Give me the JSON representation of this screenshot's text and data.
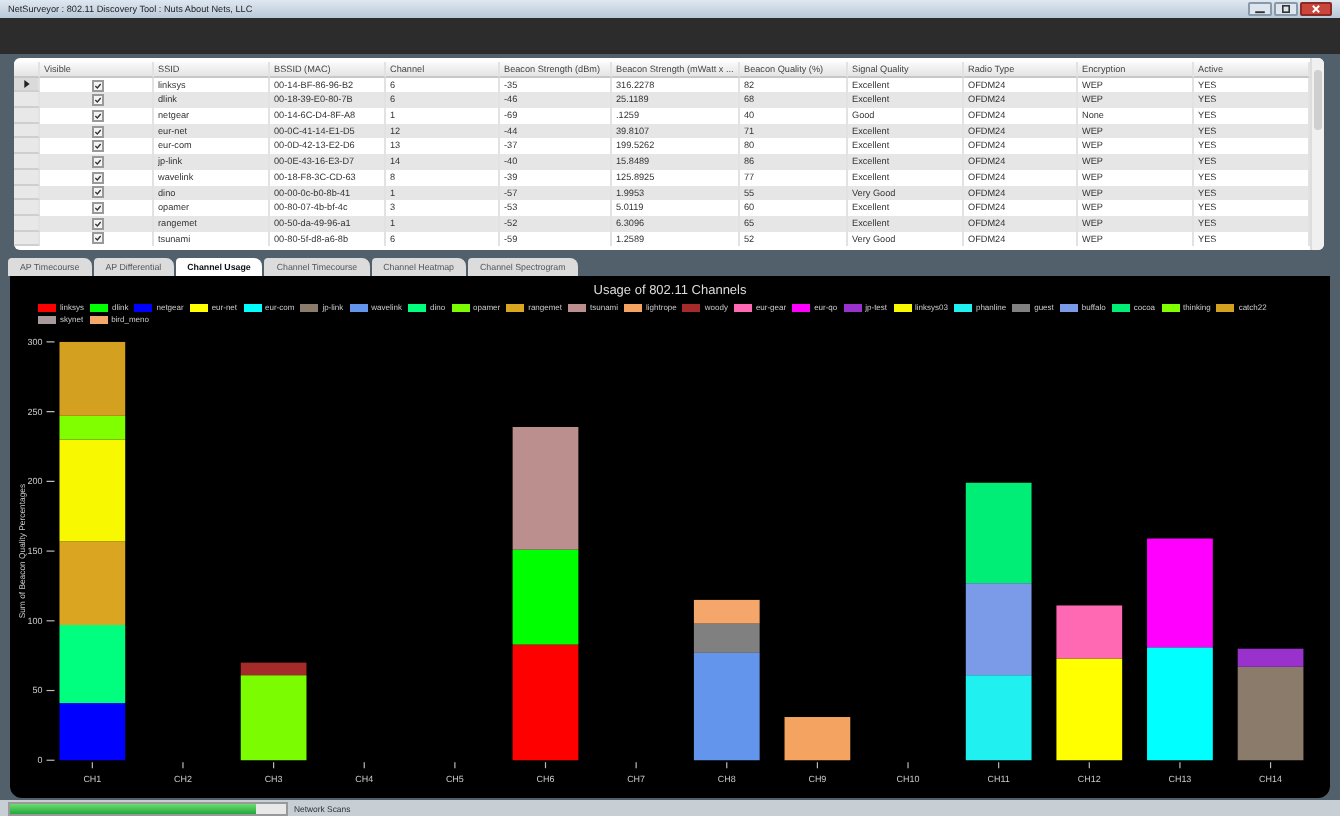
{
  "window": {
    "title": "NetSurveyor : 802.11 Discovery Tool : Nuts About Nets, LLC"
  },
  "table": {
    "columns": [
      "Visible",
      "SSID",
      "BSSID (MAC)",
      "Channel",
      "Beacon Strength (dBm)",
      "Beacon Strength (mWatt x ...",
      "Beacon Quality (%)",
      "Signal Quality",
      "Radio Type",
      "Encryption",
      "Active"
    ],
    "rows": [
      {
        "selected": true,
        "cells": [
          {
            "kind": "checkbox",
            "checked": true
          },
          "linksys",
          "00-14-BF-86-96-B2",
          "6",
          "-35",
          "316.2278",
          "82",
          "Excellent",
          "OFDM24",
          "WEP",
          "YES"
        ]
      },
      {
        "selected": false,
        "cells": [
          {
            "kind": "checkbox",
            "checked": true
          },
          "dlink",
          "00-18-39-E0-80-7B",
          "6",
          "-46",
          "25.1189",
          "68",
          "Excellent",
          "OFDM24",
          "WEP",
          "YES"
        ]
      },
      {
        "selected": false,
        "cells": [
          {
            "kind": "checkbox",
            "checked": true
          },
          "netgear",
          "00-14-6C-D4-8F-A8",
          "1",
          "-69",
          ".1259",
          "40",
          "Good",
          "OFDM24",
          "None",
          "YES"
        ]
      },
      {
        "selected": false,
        "cells": [
          {
            "kind": "checkbox",
            "checked": true
          },
          "eur-net",
          "00-0C-41-14-E1-D5",
          "12",
          "-44",
          "39.8107",
          "71",
          "Excellent",
          "OFDM24",
          "WEP",
          "YES"
        ]
      },
      {
        "selected": false,
        "cells": [
          {
            "kind": "checkbox",
            "checked": true
          },
          "eur-com",
          "00-0D-42-13-E2-D6",
          "13",
          "-37",
          "199.5262",
          "80",
          "Excellent",
          "OFDM24",
          "WEP",
          "YES"
        ]
      },
      {
        "selected": false,
        "cells": [
          {
            "kind": "checkbox",
            "checked": true
          },
          "jp-link",
          "00-0E-43-16-E3-D7",
          "14",
          "-40",
          "15.8489",
          "86",
          "Excellent",
          "OFDM24",
          "WEP",
          "YES"
        ]
      },
      {
        "selected": false,
        "cells": [
          {
            "kind": "checkbox",
            "checked": true
          },
          "wavelink",
          "00-18-F8-3C-CD-63",
          "8",
          "-39",
          "125.8925",
          "77",
          "Excellent",
          "OFDM24",
          "WEP",
          "YES"
        ]
      },
      {
        "selected": false,
        "cells": [
          {
            "kind": "checkbox",
            "checked": true
          },
          "dino",
          "00-00-0c-b0-8b-41",
          "1",
          "-57",
          "1.9953",
          "55",
          "Very Good",
          "OFDM24",
          "WEP",
          "YES"
        ]
      },
      {
        "selected": false,
        "cells": [
          {
            "kind": "checkbox",
            "checked": true
          },
          "opamer",
          "00-80-07-4b-bf-4c",
          "3",
          "-53",
          "5.0119",
          "60",
          "Excellent",
          "OFDM24",
          "WEP",
          "YES"
        ]
      },
      {
        "selected": false,
        "cells": [
          {
            "kind": "checkbox",
            "checked": true
          },
          "rangemet",
          "00-50-da-49-96-a1",
          "1",
          "-52",
          "6.3096",
          "65",
          "Excellent",
          "OFDM24",
          "WEP",
          "YES"
        ]
      },
      {
        "selected": false,
        "cells": [
          {
            "kind": "checkbox",
            "checked": true
          },
          "tsunami",
          "00-80-5f-d8-a6-8b",
          "6",
          "-59",
          "1.2589",
          "52",
          "Very Good",
          "OFDM24",
          "WEP",
          "YES"
        ]
      }
    ]
  },
  "tabs": [
    {
      "label": "AP Timecourse",
      "selected": false
    },
    {
      "label": "AP Differential",
      "selected": false
    },
    {
      "label": "Channel Usage",
      "selected": true
    },
    {
      "label": "Channel Timecourse",
      "selected": false
    },
    {
      "label": "Channel Heatmap",
      "selected": false
    },
    {
      "label": "Channel Spectrogram",
      "selected": false
    }
  ],
  "chart_data": {
    "type": "bar",
    "stacked": true,
    "legend": "top",
    "title": "Usage of 802.11 Channels",
    "ylabel": "Sum of Beacon Quality Percentages",
    "categories": [
      "CH1",
      "CH2",
      "CH3",
      "CH4",
      "CH5",
      "CH6",
      "CH7",
      "CH8",
      "CH9",
      "CH10",
      "CH11",
      "CH12",
      "CH13",
      "CH14"
    ],
    "ylim": [
      0,
      300
    ],
    "yticks": [
      0,
      50,
      100,
      150,
      200,
      250,
      300
    ],
    "series": [
      {
        "name": "linksys",
        "color": "#ff0000",
        "values": [
          null,
          null,
          null,
          null,
          null,
          83,
          null,
          null,
          null,
          null,
          null,
          null,
          null,
          null
        ]
      },
      {
        "name": "dlink",
        "color": "#00ff00",
        "values": [
          null,
          null,
          null,
          null,
          null,
          68,
          null,
          null,
          null,
          null,
          null,
          null,
          null,
          null
        ]
      },
      {
        "name": "netgear",
        "color": "#0000ff",
        "values": [
          41,
          null,
          null,
          null,
          null,
          null,
          null,
          null,
          null,
          null,
          null,
          null,
          null,
          null
        ]
      },
      {
        "name": "eur-net",
        "color": "#ffff00",
        "values": [
          null,
          null,
          null,
          null,
          null,
          null,
          null,
          null,
          null,
          null,
          null,
          73,
          null,
          null
        ]
      },
      {
        "name": "eur-com",
        "color": "#00ffff",
        "values": [
          null,
          null,
          null,
          null,
          null,
          null,
          null,
          null,
          null,
          null,
          null,
          null,
          81,
          null
        ]
      },
      {
        "name": "jp-link",
        "color": "#8b7b6b",
        "values": [
          null,
          null,
          null,
          null,
          null,
          null,
          null,
          null,
          null,
          null,
          null,
          null,
          null,
          67
        ]
      },
      {
        "name": "wavelink",
        "color": "#6495ed",
        "values": [
          null,
          null,
          null,
          null,
          null,
          null,
          null,
          77,
          null,
          null,
          null,
          null,
          null,
          null
        ]
      },
      {
        "name": "dino",
        "color": "#00ff7f",
        "values": [
          56,
          null,
          null,
          null,
          null,
          null,
          null,
          null,
          null,
          null,
          null,
          null,
          null,
          null
        ]
      },
      {
        "name": "opamer",
        "color": "#7cfc00",
        "values": [
          null,
          null,
          61,
          null,
          null,
          null,
          null,
          null,
          null,
          null,
          null,
          null,
          null,
          null
        ]
      },
      {
        "name": "rangemet",
        "color": "#daa520",
        "values": [
          60,
          null,
          null,
          null,
          null,
          null,
          null,
          null,
          null,
          null,
          null,
          null,
          null,
          null
        ]
      },
      {
        "name": "tsunami",
        "color": "#bc8f8f",
        "values": [
          null,
          null,
          null,
          null,
          null,
          88,
          null,
          null,
          null,
          null,
          null,
          null,
          null,
          null
        ]
      },
      {
        "name": "lightrope",
        "color": "#f4a460",
        "values": [
          null,
          null,
          null,
          null,
          null,
          null,
          null,
          null,
          31,
          null,
          null,
          null,
          null,
          null
        ]
      },
      {
        "name": "woody",
        "color": "#a52a2a",
        "values": [
          null,
          null,
          9,
          null,
          null,
          null,
          null,
          null,
          null,
          null,
          null,
          null,
          null,
          null
        ]
      },
      {
        "name": "eur-gear",
        "color": "#ff69b4",
        "values": [
          null,
          null,
          null,
          null,
          null,
          null,
          null,
          null,
          null,
          null,
          null,
          38,
          null,
          null
        ]
      },
      {
        "name": "eur-qo",
        "color": "#ff00ff",
        "values": [
          null,
          null,
          null,
          null,
          null,
          null,
          null,
          null,
          null,
          null,
          null,
          null,
          78,
          null
        ]
      },
      {
        "name": "jp-test",
        "color": "#9932cc",
        "values": [
          null,
          null,
          null,
          null,
          null,
          null,
          null,
          null,
          null,
          null,
          null,
          null,
          null,
          13
        ]
      },
      {
        "name": "linksys03",
        "color": "#f8f800",
        "values": [
          73,
          null,
          null,
          null,
          null,
          null,
          null,
          null,
          null,
          null,
          null,
          null,
          null,
          null
        ]
      },
      {
        "name": "phanline",
        "color": "#20f0f0",
        "values": [
          null,
          null,
          null,
          null,
          null,
          null,
          null,
          null,
          null,
          null,
          61,
          null,
          null,
          null
        ]
      },
      {
        "name": "guest",
        "color": "#808080",
        "values": [
          null,
          null,
          null,
          null,
          null,
          null,
          null,
          21,
          null,
          null,
          null,
          null,
          null,
          null
        ]
      },
      {
        "name": "buffalo",
        "color": "#7b9ae8",
        "values": [
          null,
          null,
          null,
          null,
          null,
          null,
          null,
          null,
          null,
          null,
          66,
          null,
          null,
          null
        ]
      },
      {
        "name": "cocoa",
        "color": "#00ee76",
        "values": [
          null,
          null,
          null,
          null,
          null,
          null,
          null,
          null,
          null,
          null,
          72,
          null,
          null,
          null
        ]
      },
      {
        "name": "thinking",
        "color": "#7fff00",
        "values": [
          17,
          null,
          null,
          null,
          null,
          null,
          null,
          null,
          null,
          null,
          null,
          null,
          null,
          null
        ]
      },
      {
        "name": "catch22",
        "color": "#d4a020",
        "values": [
          53,
          null,
          null,
          null,
          null,
          null,
          null,
          null,
          null,
          null,
          null,
          null,
          null,
          null
        ]
      },
      {
        "name": "skynet",
        "color": "#a89a9a",
        "values": [
          null,
          null,
          null,
          null,
          null,
          null,
          null,
          null,
          null,
          null,
          null,
          null,
          null,
          null
        ]
      },
      {
        "name": "bird_meno",
        "color": "#f5a66a",
        "values": [
          null,
          null,
          null,
          null,
          null,
          null,
          null,
          17,
          null,
          null,
          null,
          null,
          null,
          null
        ]
      }
    ]
  },
  "status_bar": {
    "progress": {
      "level": 0.89
    },
    "text": "Network Scans"
  }
}
